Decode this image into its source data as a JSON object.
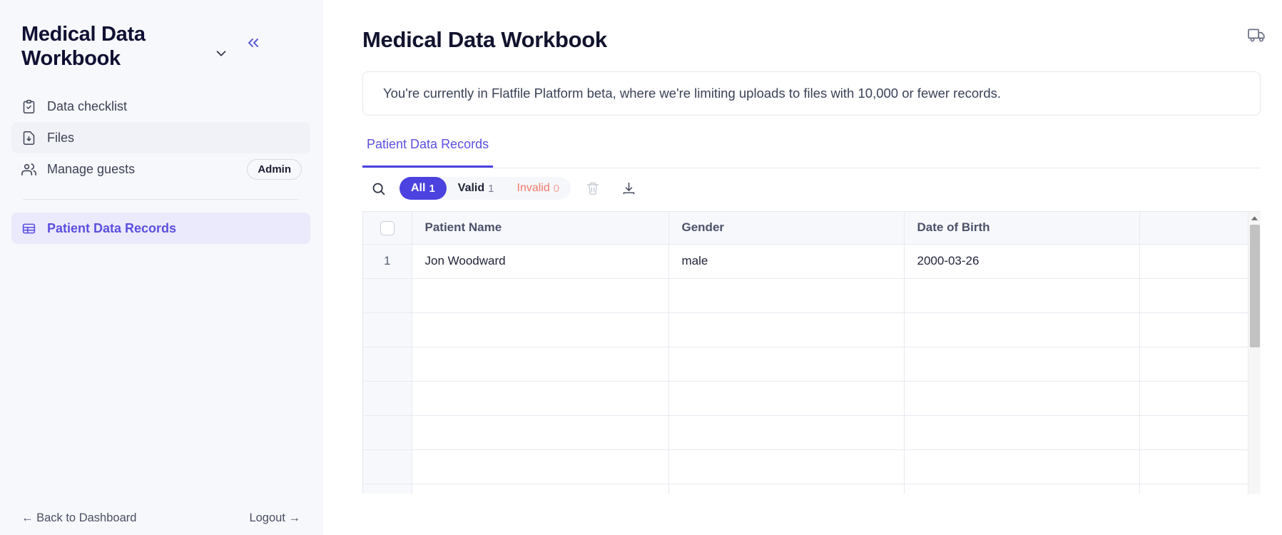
{
  "sidebar": {
    "workspace_title": "Medical Data Workbook",
    "chevron_icon": "chevron-down-icon",
    "collapse_icon": "collapse-left-icon",
    "items": [
      {
        "label": "Data checklist",
        "icon": "clipboard-check-icon",
        "state": "default",
        "badge": ""
      },
      {
        "label": "Files",
        "icon": "file-download-icon",
        "state": "hover",
        "badge": ""
      },
      {
        "label": "Manage guests",
        "icon": "users-icon",
        "state": "default",
        "badge": "Admin"
      }
    ],
    "section_items": [
      {
        "label": "Patient Data Records",
        "icon": "table-grid-icon",
        "state": "active"
      }
    ],
    "footer": {
      "back_label": "← Back to Dashboard",
      "logout_label": "Logout →"
    }
  },
  "main": {
    "page_title": "Medical Data Workbook",
    "header_icon": "truck-icon",
    "banner_text": "You're currently in Flatfile Platform beta, where we're limiting uploads to files with 10,000 or fewer records.",
    "tabs": [
      {
        "label": "Patient Data Records",
        "active": true
      }
    ],
    "toolbar": {
      "search_icon": "search-icon",
      "filters": [
        {
          "key": "all",
          "label": "All",
          "count": "1",
          "selected": true
        },
        {
          "key": "valid",
          "label": "Valid",
          "count": "1",
          "selected": false
        },
        {
          "key": "invalid",
          "label": "Invalid",
          "count": "0",
          "selected": false
        }
      ],
      "delete_icon": "trash-icon",
      "delete_enabled": false,
      "download_icon": "download-icon",
      "download_enabled": true
    },
    "table": {
      "select_all_checkbox": "unchecked",
      "columns": [
        "Patient Name",
        "Gender",
        "Date of Birth"
      ],
      "rows": [
        {
          "num": "1",
          "Patient Name": "Jon Woodward",
          "Gender": "male",
          "Date of Birth": "2000-03-26"
        },
        {
          "num": "",
          "Patient Name": "",
          "Gender": "",
          "Date of Birth": ""
        },
        {
          "num": "",
          "Patient Name": "",
          "Gender": "",
          "Date of Birth": ""
        },
        {
          "num": "",
          "Patient Name": "",
          "Gender": "",
          "Date of Birth": ""
        },
        {
          "num": "",
          "Patient Name": "",
          "Gender": "",
          "Date of Birth": ""
        },
        {
          "num": "",
          "Patient Name": "",
          "Gender": "",
          "Date of Birth": ""
        },
        {
          "num": "",
          "Patient Name": "",
          "Gender": "",
          "Date of Birth": ""
        },
        {
          "num": "",
          "Patient Name": "",
          "Gender": "",
          "Date of Birth": ""
        }
      ],
      "scrollbar_up_icon": "scroll-up-arrow-icon"
    }
  },
  "colors": {
    "accent_purple": "#4b42e0",
    "accent_purple_light": "#ebeafc",
    "invalid_orange": "#f07a6a",
    "sidebar_bg": "#f7f8fb",
    "header_row_bg": "#f7f8fc",
    "border": "#e6e8ef"
  }
}
